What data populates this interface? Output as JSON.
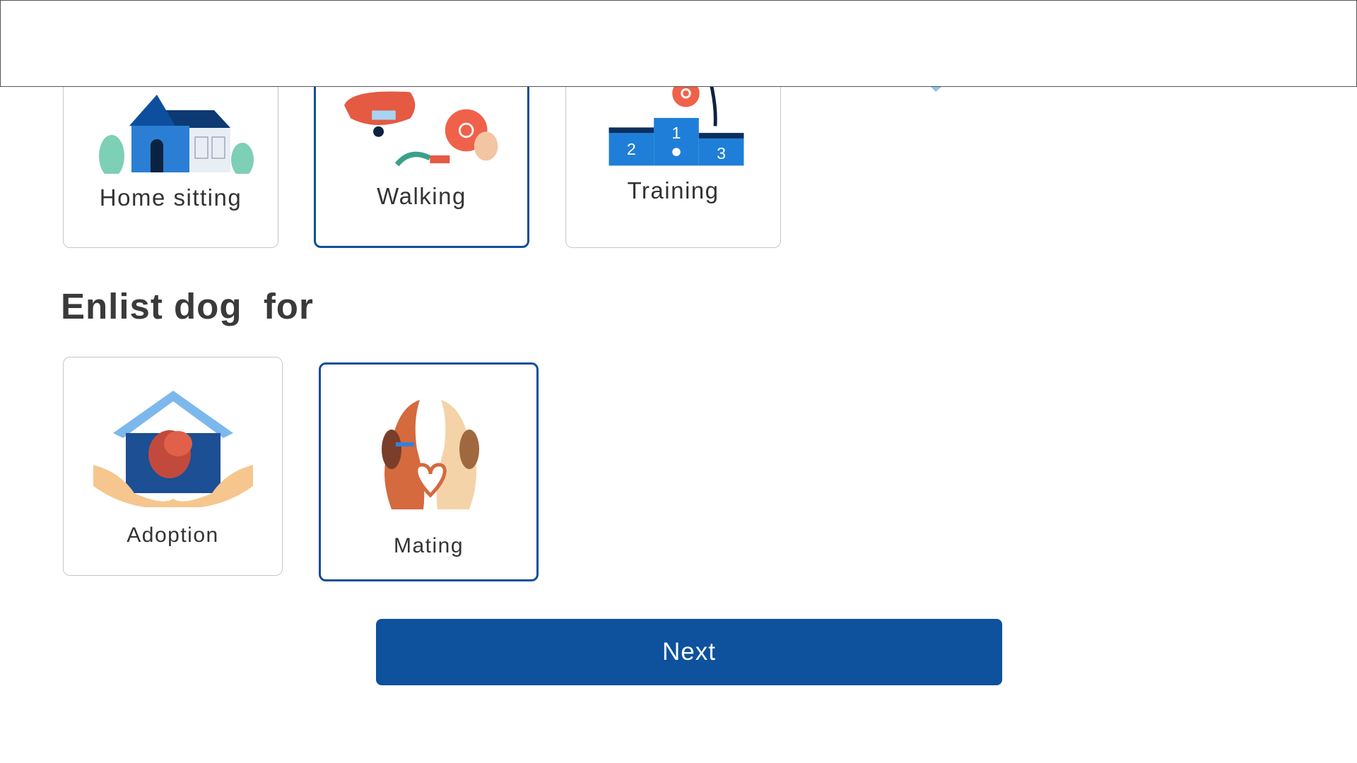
{
  "services": [
    {
      "label": "Home sitting",
      "icon": "house-icon",
      "selected": false
    },
    {
      "label": "Walking",
      "icon": "leash-collar-icon",
      "selected": true
    },
    {
      "label": "Training",
      "icon": "podium-icon",
      "selected": false
    }
  ],
  "enlist": {
    "title": "Enlist dog  for",
    "options": [
      {
        "label": "Adoption",
        "icon": "doghouse-hands-icon",
        "selected": false
      },
      {
        "label": "Mating",
        "icon": "dogs-heart-icon",
        "selected": true
      }
    ]
  },
  "next_button": {
    "label": "Next"
  },
  "colors": {
    "primary": "#0e519d",
    "selected_border": "#0e4f9a",
    "card_border": "#c8c8c8",
    "text": "#333333"
  }
}
